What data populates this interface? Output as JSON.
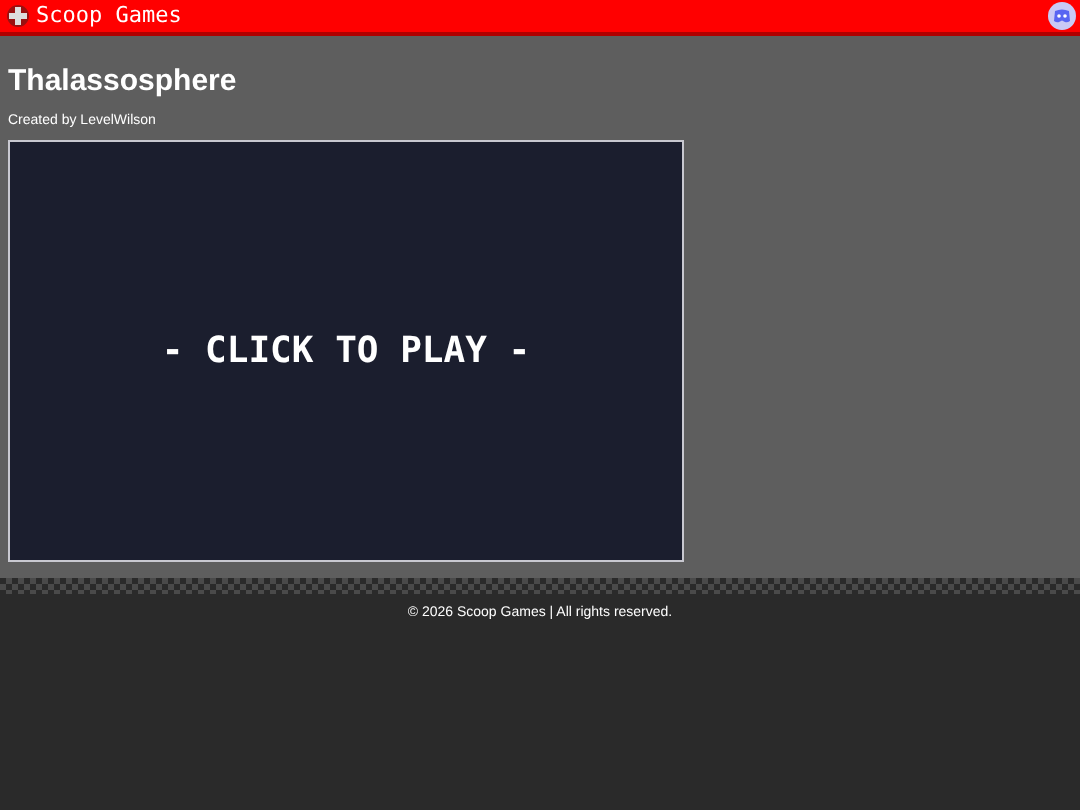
{
  "header": {
    "brand": "Scoop Games"
  },
  "game": {
    "title": "Thalassosphere",
    "credit": "Created by LevelWilson",
    "play_label": "- CLICK TO PLAY -"
  },
  "footer": {
    "text": "© 2026 Scoop Games | All rights reserved."
  }
}
